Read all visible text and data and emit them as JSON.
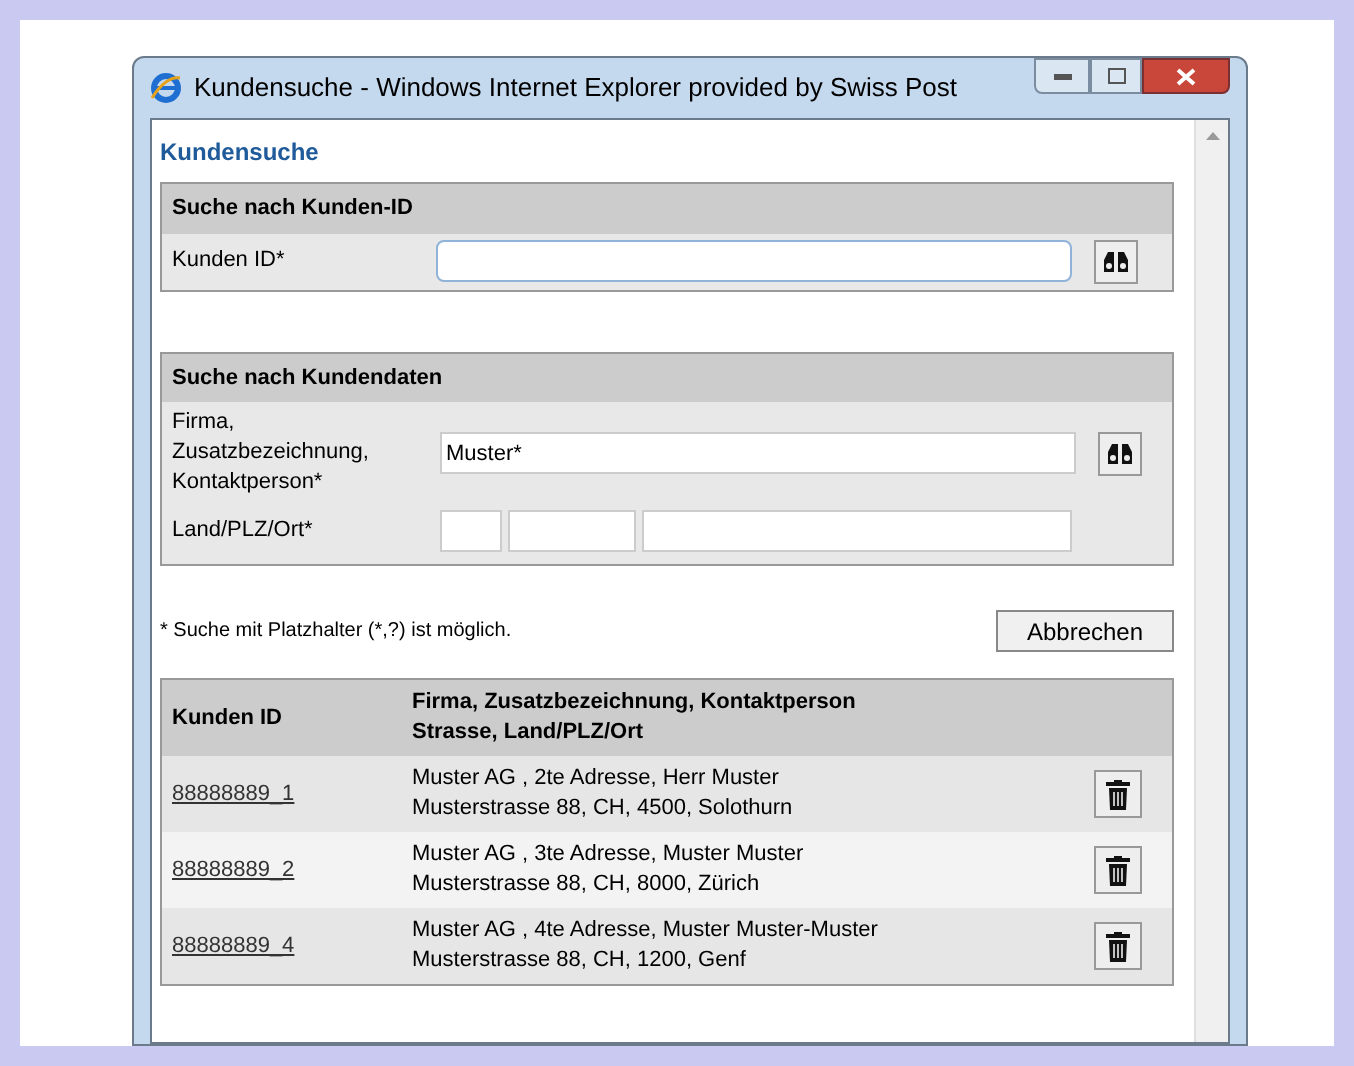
{
  "window": {
    "title": "Kundensuche - Windows Internet Explorer provided by Swiss Post"
  },
  "page_title": "Kundensuche",
  "id_search": {
    "heading": "Suche nach Kunden-ID",
    "label": "Kunden ID*"
  },
  "data_search": {
    "heading": "Suche nach Kundendaten",
    "name_label": "Firma, Zusatzbezeichnung, Kontaktperson*",
    "name_value": "Muster*",
    "location_label": "Land/PLZ/Ort*"
  },
  "note": "* Suche mit Platzhalter (*,?) ist möglich.",
  "cancel_button": "Abbrechen",
  "table": {
    "columns": [
      "Kunden ID",
      "Firma, Zusatzbezeichnung, Kontaktperson\nStrasse, Land/PLZ/Ort"
    ],
    "rows": [
      {
        "id": "88888889_1",
        "line1": "Muster AG , 2te Adresse, Herr Muster",
        "line2": "Musterstrasse 88, CH, 4500, Solothurn"
      },
      {
        "id": "88888889_2",
        "line1": "Muster AG , 3te Adresse, Muster Muster",
        "line2": "Musterstrasse 88, CH, 8000, Zürich"
      },
      {
        "id": "88888889_4",
        "line1": "Muster AG , 4te Adresse, Muster Muster-Muster",
        "line2": "Musterstrasse 88, CH, 1200, Genf"
      }
    ]
  }
}
